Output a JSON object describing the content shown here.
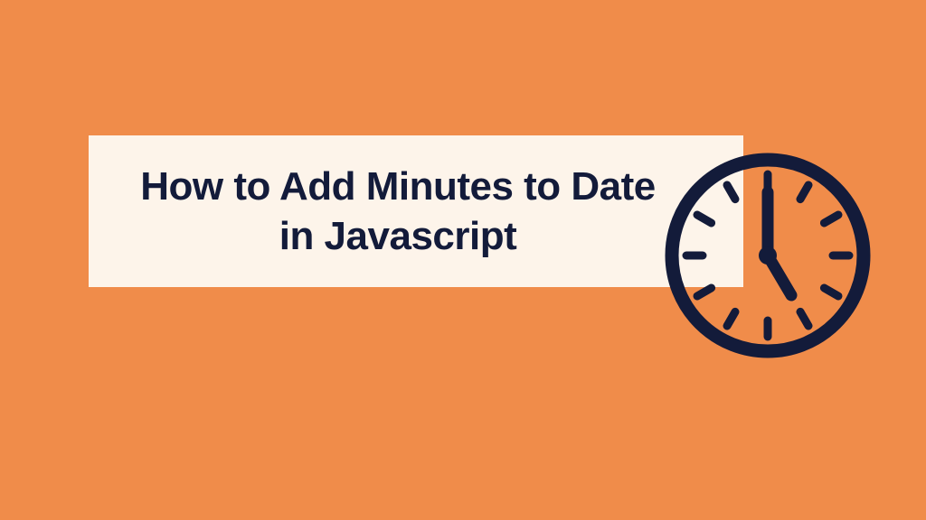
{
  "banner": {
    "title": "How to Add Minutes to Date in Javascript"
  },
  "colors": {
    "background": "#f08c4a",
    "title_box": "#fdf4ea",
    "text_and_icon": "#131b3a"
  }
}
